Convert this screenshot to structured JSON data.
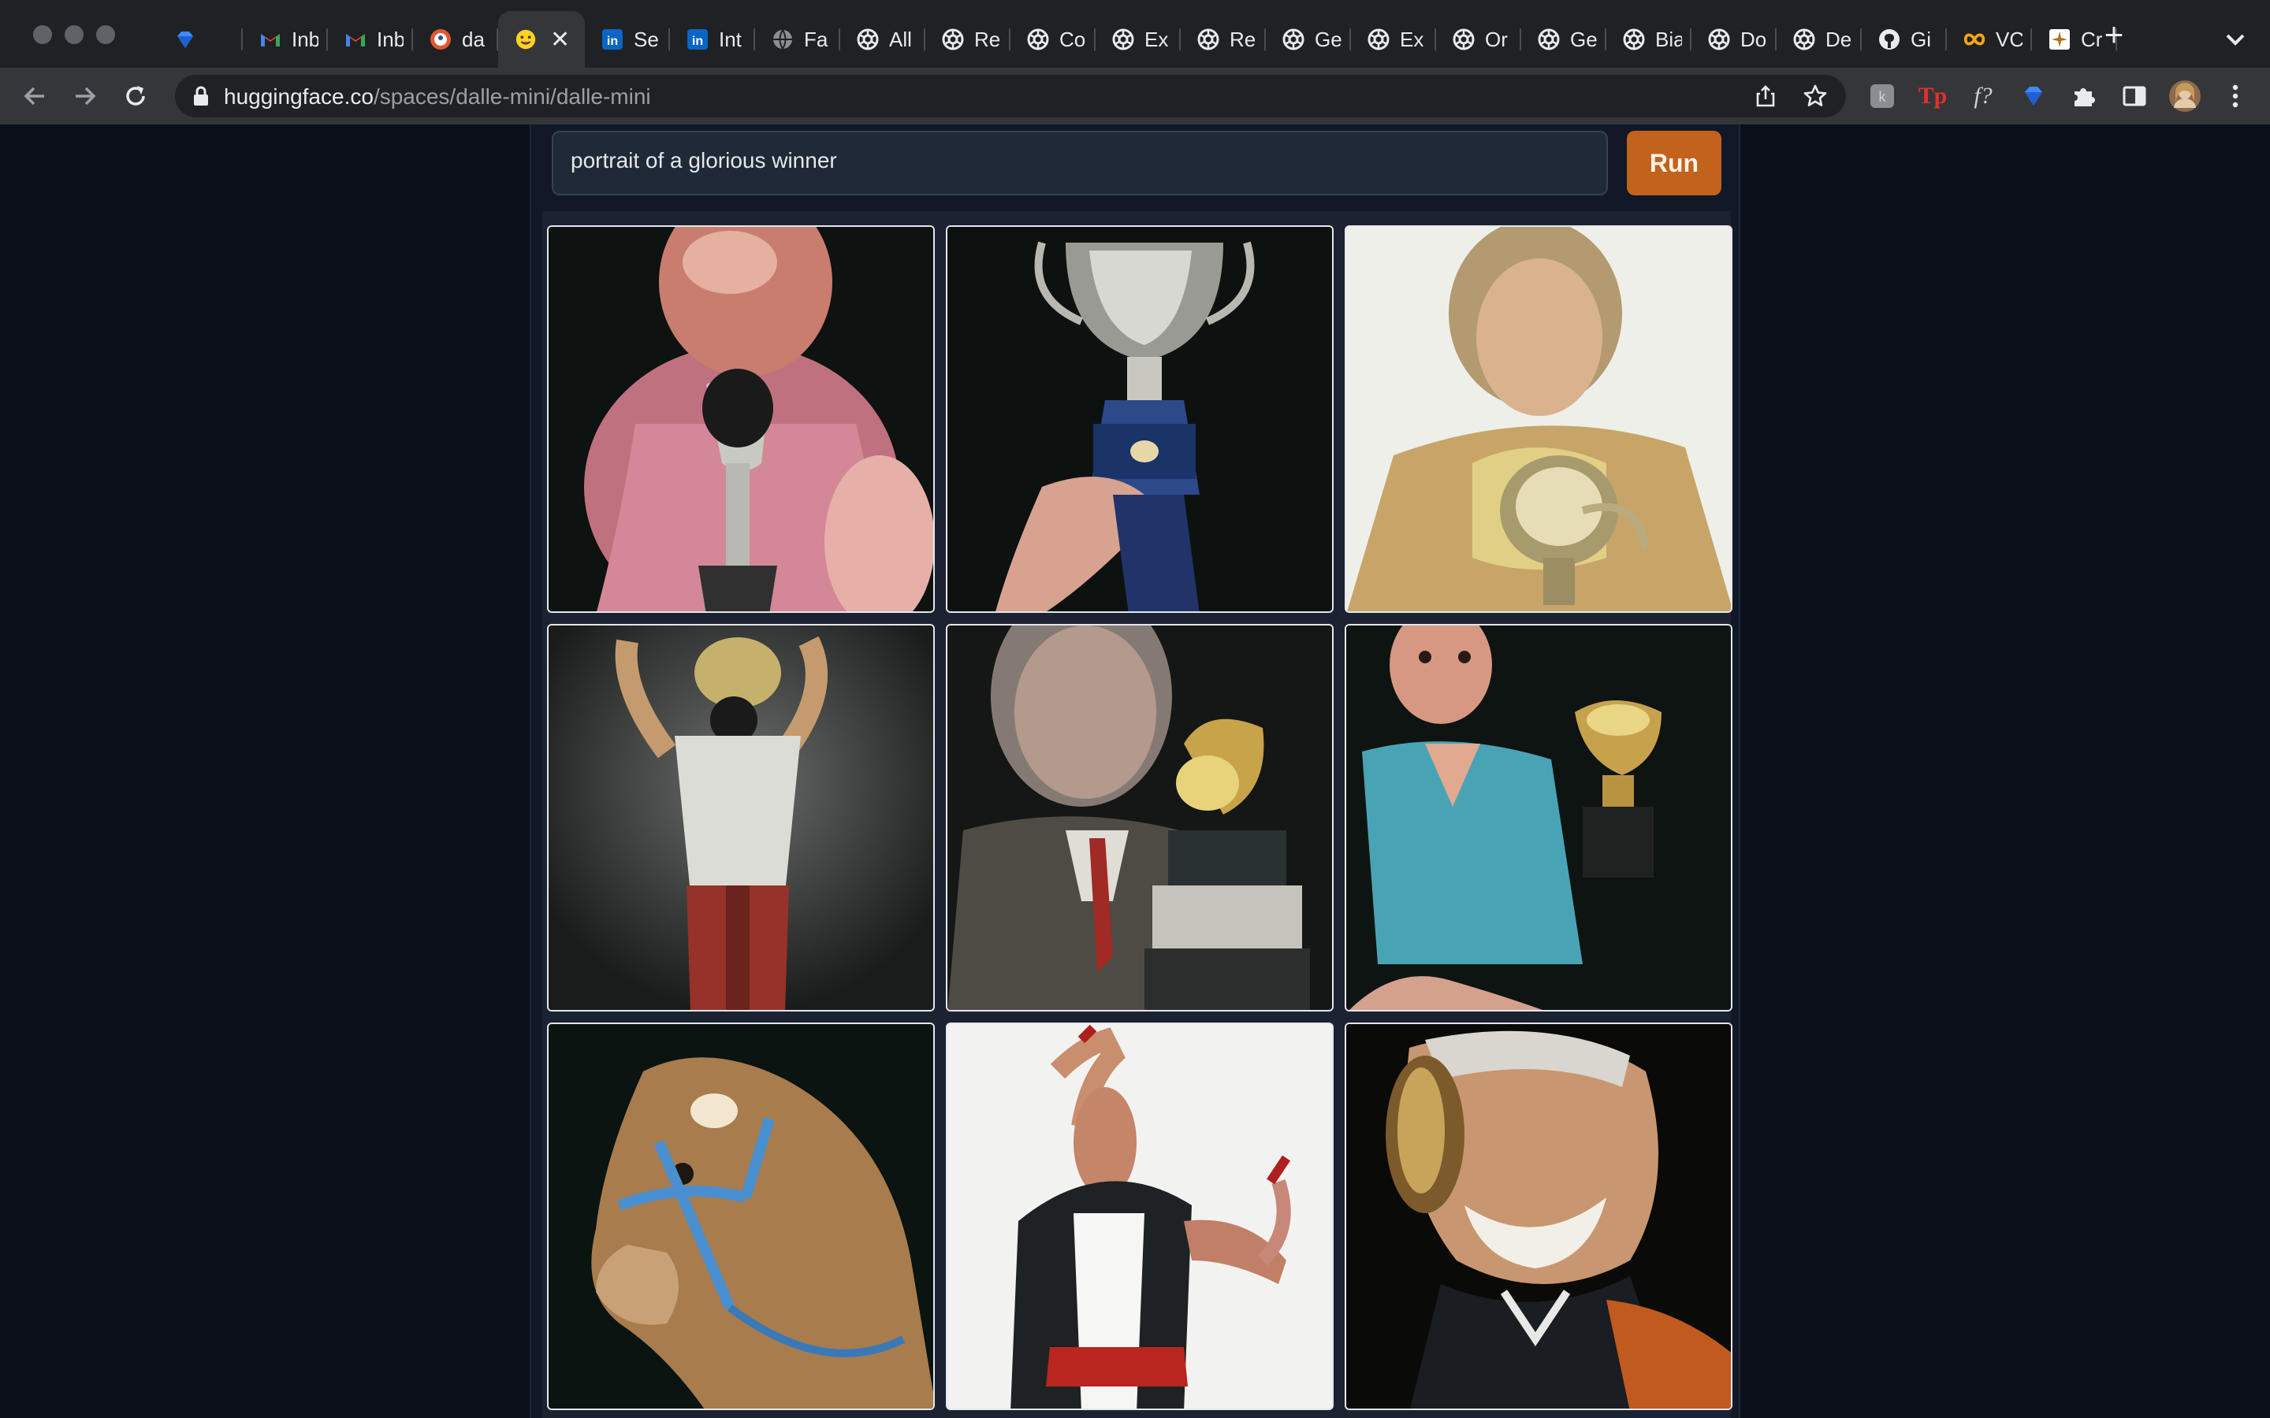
{
  "browser": {
    "tabs": [
      {
        "icon": "diamond-icon",
        "title": ""
      },
      {
        "icon": "gmail-icon",
        "title": "Inb"
      },
      {
        "icon": "gmail-icon",
        "title": "Inb"
      },
      {
        "icon": "duckduckgo-icon",
        "title": "da"
      },
      {
        "icon": "huggingface-icon",
        "title": "",
        "active": true
      },
      {
        "icon": "linkedin-icon",
        "title": "Se"
      },
      {
        "icon": "linkedin-icon",
        "title": "Int"
      },
      {
        "icon": "globe-icon",
        "title": "Fa"
      },
      {
        "icon": "openai-icon",
        "title": "All"
      },
      {
        "icon": "openai-icon",
        "title": "Re"
      },
      {
        "icon": "openai-icon",
        "title": "Co"
      },
      {
        "icon": "openai-icon",
        "title": "Ex"
      },
      {
        "icon": "openai-icon",
        "title": "Re"
      },
      {
        "icon": "openai-icon",
        "title": "Ge"
      },
      {
        "icon": "openai-icon",
        "title": "Ex"
      },
      {
        "icon": "openai-icon",
        "title": "Or"
      },
      {
        "icon": "openai-icon",
        "title": "Ge"
      },
      {
        "icon": "openai-icon",
        "title": "Bia"
      },
      {
        "icon": "openai-icon",
        "title": "Do"
      },
      {
        "icon": "openai-icon",
        "title": "De"
      },
      {
        "icon": "github-icon",
        "title": "Gi"
      },
      {
        "icon": "infinity-icon",
        "title": "VC"
      },
      {
        "icon": "sparkle-icon",
        "title": "Cr"
      }
    ],
    "close_glyph": "✕",
    "new_tab_glyph": "+",
    "url_domain": "huggingface.co",
    "url_path": "/spaces/dalle-mini/dalle-mini",
    "extensions": [
      "generic-extension-icon",
      "tp-extension-icon",
      "fx-extension-icon",
      "diamond-extension-icon",
      "puzzle-icon",
      "side-panel-icon",
      "profile-avatar",
      "kebab-menu-icon"
    ],
    "extension_labels": {
      "tp": "Tp",
      "fx": "f?"
    }
  },
  "app": {
    "prompt_value": "portrait of a glorious winner",
    "run_label": "Run",
    "accent_color": "#c2621d",
    "images": [
      {
        "subject": "man-holding-trophy-pink-shirt",
        "bg": "#0e1210"
      },
      {
        "subject": "hand-holding-silver-trophy",
        "bg": "#0d1211"
      },
      {
        "subject": "woman-with-gold-trophy",
        "bg": "#efefe9"
      },
      {
        "subject": "person-raising-trophy-overhead",
        "bg": "#3b3f3d"
      },
      {
        "subject": "man-in-suit-with-trophy",
        "bg": "#151716"
      },
      {
        "subject": "woman-teal-top-with-trophy",
        "bg": "#0e1412"
      },
      {
        "subject": "horse-with-blue-halter",
        "bg": "#0a1410"
      },
      {
        "subject": "man-celebrating-white-bg",
        "bg": "#f2f2f0"
      },
      {
        "subject": "smiling-man-with-trophy",
        "bg": "#0a0a08"
      }
    ]
  }
}
